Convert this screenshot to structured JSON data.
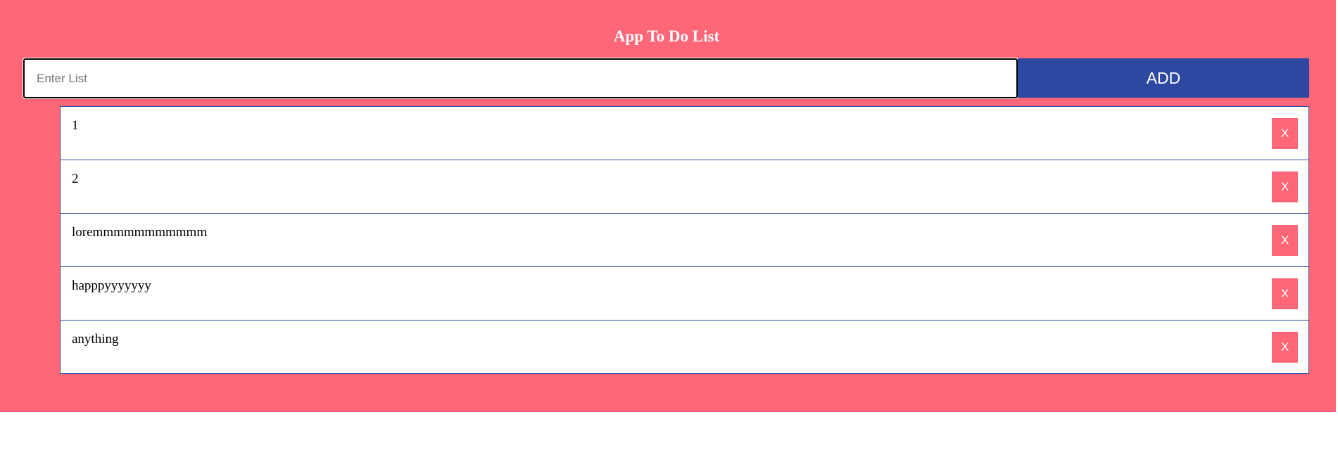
{
  "app": {
    "title": "App To Do List"
  },
  "input": {
    "value": "",
    "placeholder": "Enter List"
  },
  "add_button": {
    "label": "ADD"
  },
  "todos": [
    {
      "text": "1",
      "delete_label": "X"
    },
    {
      "text": "2",
      "delete_label": "X"
    },
    {
      "text": "loremmmmmmmmmmm",
      "delete_label": "X"
    },
    {
      "text": "happpyyyyyyy",
      "delete_label": "X"
    },
    {
      "text": "anything",
      "delete_label": "X"
    }
  ],
  "colors": {
    "background": "#ff6677",
    "accent": "#2c48a0",
    "item_background": "#ffffff"
  }
}
